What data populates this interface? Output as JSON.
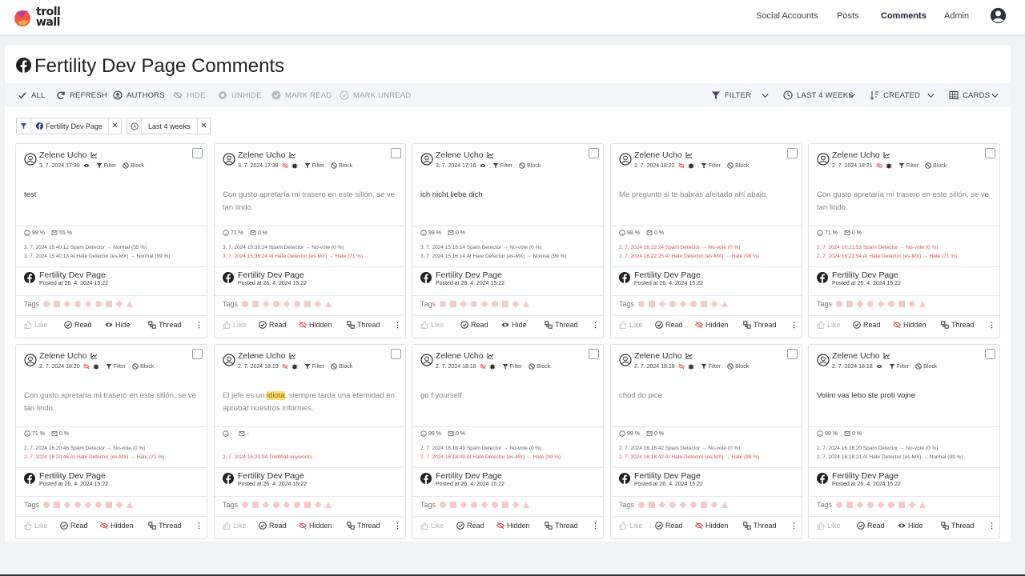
{
  "brand": {
    "logo_text": "troll wall"
  },
  "nav": {
    "items": [
      "Social Accounts",
      "Posts",
      "Comments",
      "Admin"
    ],
    "active": "Comments"
  },
  "page": {
    "title": "Fertility Dev Page Comments"
  },
  "toolbar": {
    "all": "ALL",
    "refresh": "REFRESH",
    "authors": "AUTHORS",
    "hide": "HIDE",
    "unhide": "UNHIDE",
    "mark_read": "MARK READ",
    "mark_unread": "MARK UNREAD",
    "filter": "FILTER",
    "range": "LAST 4 WEEKS",
    "sort": "CREATED",
    "view": "CARDS"
  },
  "chips": {
    "page": "Fertility Dev Page",
    "range": "Last 4 weeks"
  },
  "labels": {
    "filter": "Filter",
    "block": "Block",
    "tags": "Tags",
    "like": "Like",
    "read": "Read",
    "hide": "Hide",
    "hidden": "Hidden",
    "thread": "Thread",
    "page": "Fertility Dev Page",
    "posted": "Posted at 26. 4. 2024 15:22"
  },
  "colors": {
    "accent": "#3d4a78",
    "danger": "#d9534f",
    "highlight": "#fbe27a"
  },
  "cards": [
    {
      "author": "Zelene Ucho",
      "date": "3. 7. 2024 17:39",
      "text": "test",
      "dim": false,
      "score1": "99 %",
      "score2": "55 %",
      "log1": "3. 7. 2024 15:40:12 Spam Detector → Normal (55 %)",
      "log2": "3. 7. 2024 15:40:13 AI Hate Detector (es-MX) → Normal (99 %)",
      "log2_red": false,
      "log1_red": false,
      "action": "Hide",
      "hidden": false
    },
    {
      "author": "Zelene Ucho",
      "date": "3. 7. 2024 17:38",
      "text": "Con gusto apretaría mi trasero en este sillón, se ve tan lindo.",
      "dim": true,
      "score1": "71 %",
      "score2": "0 %",
      "log1": "3. 7. 2024 15:38:24 Spam Detector → No-vote (0 %)",
      "log2": "3. 7. 2024 15:38:24 AI Hate Detector (es-MX) → Hate (71 %)",
      "log2_red": true,
      "log1_red": false,
      "action": "Hidden",
      "hidden": true
    },
    {
      "author": "Zelene Ucho",
      "date": "3. 7. 2024 17:16",
      "text": "ich nicht liebe dich",
      "dim": false,
      "score1": "99 %",
      "score2": "0 %",
      "log1": "3. 7. 2024 15:16:14 Spam Detector → No-vote (0 %)",
      "log2": "3. 7. 2024 15:16:14 AI Hate Detector (es-MX) → Normal (99 %)",
      "log2_red": false,
      "log1_red": false,
      "action": "Hide",
      "hidden": false
    },
    {
      "author": "Zelene Ucho",
      "date": "2. 7. 2024 18:22",
      "text": "Me pregunto si te habrás afeitado ahí abajo.",
      "dim": true,
      "score1": "98 %",
      "score2": "0 %",
      "log1": "2. 7. 2024 16:22:24 Spam Detector → No-vote (0 %)",
      "log2": "2. 7. 2024 16:22:25 AI Hate Detector (es-MX) → Hate (98 %)",
      "log2_red": true,
      "log1_red": true,
      "action": "Hidden",
      "hidden": true
    },
    {
      "author": "Zelene Ucho",
      "date": "2. 7. 2024 18:21",
      "text": "Con gusto apretaría mi trasero en este sillón, se ve tan lindo.",
      "dim": true,
      "score1": "71 %",
      "score2": "0 %",
      "log1": "2. 7. 2024 16:21:53 Spam Detector → No-vote (0 %)",
      "log2": "2. 7. 2024 16:21:54 AI Hate Detector (es-MX) → Hate (71 %)",
      "log2_red": true,
      "log1_red": true,
      "action": "Hidden",
      "hidden": true
    },
    {
      "author": "Zelene Ucho",
      "date": "2. 7. 2024 18:20",
      "text": "Con gusto apretaría mi trasero en este sillón, se ve tan lindo.",
      "dim": true,
      "score1": "71 %",
      "score2": "0 %",
      "log1": "2. 7. 2024 16:20:46 Spam Detector → No-vote (0 %)",
      "log2": "2. 7. 2024 16:20:46 AI Hate Detector (es-MX) → Hate (71 %)",
      "log2_red": true,
      "log1_red": false,
      "action": "Hidden",
      "hidden": true
    },
    {
      "author": "Zelene Ucho",
      "date": "2. 7. 2024 18:19",
      "text_before": "El jefe es un ",
      "text_hl": "idiota",
      "text_after": ", siempre tarda una eternidad en aprobar nuestros informes.",
      "dim": true,
      "score1": "-",
      "score2": "-",
      "log1": "",
      "log2": "2. 7. 2024 16:20:04 TrollWall keywords",
      "log2_red": true,
      "log1_red": false,
      "action": "Hidden",
      "hidden": true
    },
    {
      "author": "Zelene Ucho",
      "date": "2. 7. 2024 18:18",
      "text": "go f yourself",
      "dim": true,
      "score1": "99 %",
      "score2": "0 %",
      "log1": "2. 7. 2024 16:18:49 Spam Detector → No-vote (0 %)",
      "log2": "2. 7. 2024 16:18:49 AI Hate Detector (es-MX) → Hate (99 %)",
      "log2_red": true,
      "log1_red": false,
      "action": "Hidden",
      "hidden": true
    },
    {
      "author": "Zelene Ucho",
      "date": "2. 7. 2024 18:18",
      "text": "chod do pice",
      "dim": true,
      "score1": "99 %",
      "score2": "0 %",
      "log1": "2. 7. 2024 16:18:42 Spam Detector → No-vote (0 %)",
      "log2": "2. 7. 2024 16:18:42 AI Hate Detector (es-MX) → Hate (99 %)",
      "log2_red": true,
      "log1_red": false,
      "action": "Hidden",
      "hidden": true
    },
    {
      "author": "Zelene Ucho",
      "date": "2. 7. 2024 18:18",
      "text": "Volim vas lebo ste proti vojne",
      "dim": false,
      "score1": "99 %",
      "score2": "0 %",
      "log1": "2. 7. 2024 16:18:20 Spam Detector → No-vote (0 %)",
      "log2": "2. 7. 2024 16:18:21 AI Hate Detector (es-MX) → Normal (99 %)",
      "log2_red": false,
      "log1_red": false,
      "action": "Hide",
      "hidden": false
    }
  ]
}
